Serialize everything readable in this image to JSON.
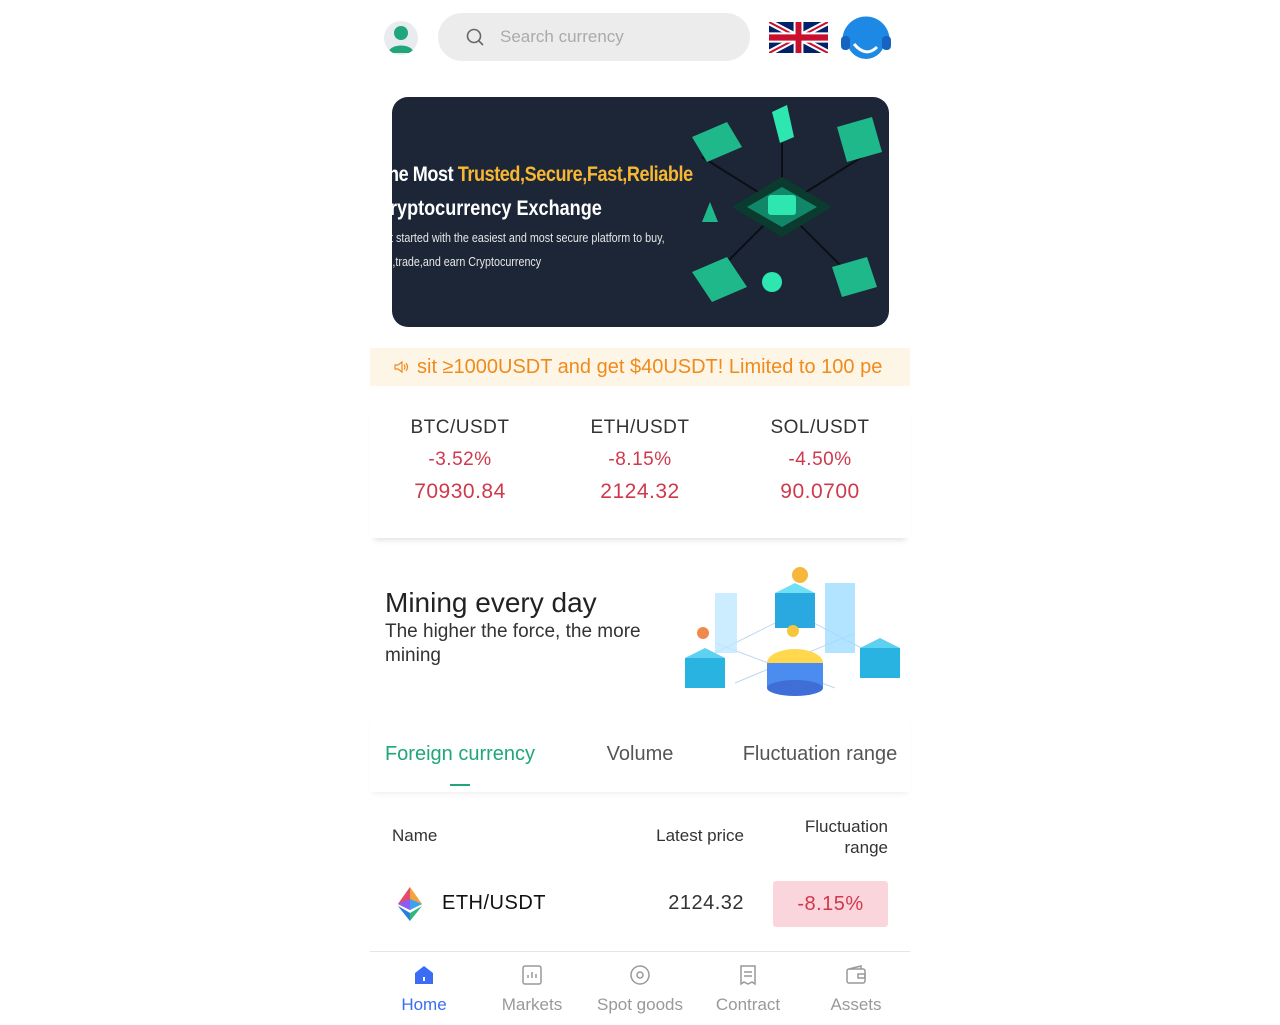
{
  "search": {
    "placeholder": "Search currency"
  },
  "banner": {
    "line1_prefix": "he Most ",
    "line1_highlight": "Trusted,Secure,Fast,Reliable",
    "line2": "ryptocurrency Exchange",
    "sub1": "t started with the easiest and most secure platform to buy,",
    "sub2": "l,trade,and earn Cryptocurrency"
  },
  "notice": {
    "text": "sit ≥1000USDT and get $40USDT! Limited to 100 pe"
  },
  "tickers": [
    {
      "pair": "BTC/USDT",
      "change": "-3.52%",
      "price": "70930.84"
    },
    {
      "pair": "ETH/USDT",
      "change": "-8.15%",
      "price": "2124.32"
    },
    {
      "pair": "SOL/USDT",
      "change": "-4.50%",
      "price": "90.0700"
    }
  ],
  "mining": {
    "title": "Mining every day",
    "subtitle": "The higher the force, the more mining"
  },
  "tabs": [
    "Foreign currency",
    "Volume",
    "Fluctuation range"
  ],
  "table": {
    "headers": {
      "name": "Name",
      "price": "Latest price",
      "range": "Fluctuation range"
    },
    "rows": [
      {
        "name": "ETH/USDT",
        "price": "2124.32",
        "range": "-8.15%"
      }
    ]
  },
  "nav": [
    "Home",
    "Markets",
    "Spot goods",
    "Contract",
    "Assets"
  ],
  "colors": {
    "accent": "#1fa67a",
    "down": "#d0384c",
    "nav_active": "#3b6cf6",
    "notice": "#f08a1c"
  }
}
